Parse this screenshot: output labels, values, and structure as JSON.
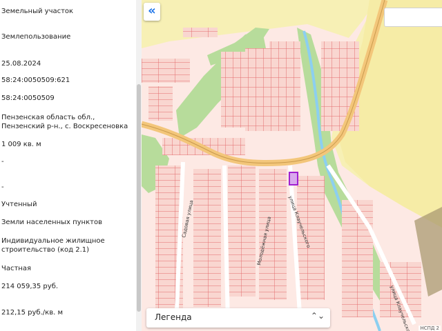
{
  "info": {
    "rows": [
      "Земельный участок",
      "Землепользование",
      "25.08.2024",
      "58:24:0050509:621",
      "58:24:0050509",
      "Пензенская область обл.,",
      "Пензенский р-н., с. Воскресеновка",
      "1 009 кв. м",
      "-",
      "-",
      "Учтенный",
      "Земли населенных пунктов",
      "Индивидуальное жилищное",
      "строительство (код 2.1)",
      "Частная",
      "214 059,35 руб.",
      "212,15 руб./кв. м"
    ]
  },
  "map": {
    "collapse_icon": "«",
    "streets": [
      "Садовая улица",
      "Молодёжная улица",
      "улица Клаучельского",
      "улица Клаучельского"
    ],
    "legend_label": "Легенда",
    "legend_icon": "⌃⌄",
    "attribution": "НСПД 2",
    "colors": {
      "farmland": "#f7f0b5",
      "settlement": "#fde9e4",
      "parcel_fill": "#f9d6d0",
      "parcel_line": "#e26b6b",
      "forest": "#b7dc9b",
      "road": "#f3c67a",
      "river": "#8ccff0",
      "selected": "#a020d0"
    }
  }
}
